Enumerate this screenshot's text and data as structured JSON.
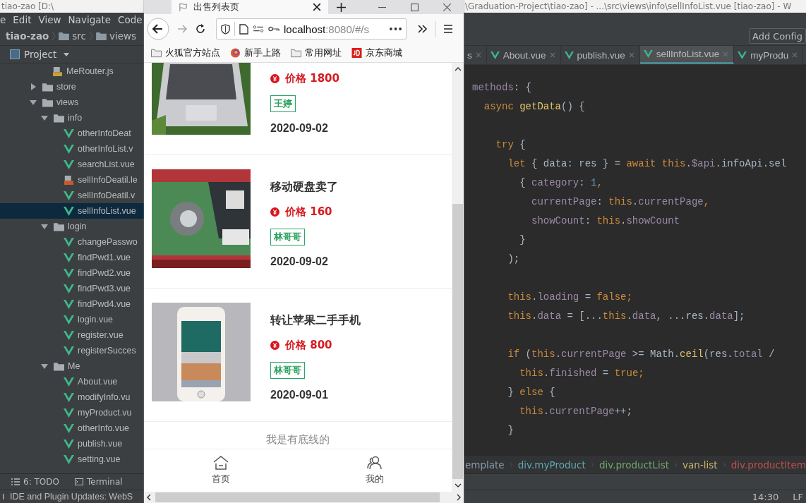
{
  "ide": {
    "title_left": "tiao-zao [D:\\",
    "title_right": "\\Graduation-Project\\tiao-zao] - ...\\src\\views\\info\\sellInfoList.vue [tiao-zao] - W",
    "menu": [
      "e",
      "Edit",
      "View",
      "Navigate",
      "Code"
    ],
    "path": [
      "tiao-zao",
      "src",
      "views"
    ],
    "add_config": "Add Config",
    "project_label": "Project",
    "tree": [
      {
        "label": "MeRouter.js",
        "kind": "js",
        "selected": false
      },
      {
        "label": "store",
        "kind": "folder",
        "expanded": false,
        "selected": false
      },
      {
        "label": "views",
        "kind": "folder",
        "expanded": true,
        "selected": false,
        "children": [
          {
            "label": "info",
            "kind": "folder",
            "expanded": true,
            "selected": false,
            "children": [
              {
                "label": "otherInfoDeat",
                "kind": "vue",
                "selected": false
              },
              {
                "label": "otherInfoList.v",
                "kind": "vue",
                "selected": false
              },
              {
                "label": "searchList.vue",
                "kind": "vue",
                "selected": false
              },
              {
                "label": "sellInfoDeatil.le",
                "kind": "less",
                "selected": false
              },
              {
                "label": "sellInfoDeatil.v",
                "kind": "vue",
                "selected": false
              },
              {
                "label": "sellInfoList.vue",
                "kind": "vue",
                "selected": true
              }
            ]
          },
          {
            "label": "login",
            "kind": "folder",
            "expanded": true,
            "selected": false,
            "children": [
              {
                "label": "changePasswo",
                "kind": "vue",
                "selected": false
              },
              {
                "label": "findPwd1.vue",
                "kind": "vue",
                "selected": false
              },
              {
                "label": "findPwd2.vue",
                "kind": "vue",
                "selected": false
              },
              {
                "label": "findPwd3.vue",
                "kind": "vue",
                "selected": false
              },
              {
                "label": "findPwd4.vue",
                "kind": "vue",
                "selected": false
              },
              {
                "label": "login.vue",
                "kind": "vue",
                "selected": false
              },
              {
                "label": "register.vue",
                "kind": "vue",
                "selected": false
              },
              {
                "label": "registerSucces",
                "kind": "vue",
                "selected": false
              }
            ]
          },
          {
            "label": "Me",
            "kind": "folder",
            "expanded": true,
            "selected": false,
            "children": [
              {
                "label": "About.vue",
                "kind": "vue",
                "selected": false
              },
              {
                "label": "modifyInfo.vu",
                "kind": "vue",
                "selected": false
              },
              {
                "label": "myProduct.vu",
                "kind": "vue",
                "selected": false
              },
              {
                "label": "otherInfo.vue",
                "kind": "vue",
                "selected": false
              },
              {
                "label": "publish.vue",
                "kind": "vue",
                "selected": false
              },
              {
                "label": "setting.vue",
                "kind": "vue",
                "selected": false
              }
            ]
          }
        ]
      }
    ],
    "tabs": [
      {
        "label": "s",
        "selected": false
      },
      {
        "label": "About.vue",
        "kind": "vue",
        "selected": false
      },
      {
        "label": "publish.vue",
        "kind": "vue",
        "selected": false
      },
      {
        "label": "sellInfoList.vue",
        "kind": "vue",
        "selected": true
      },
      {
        "label": "myProdu",
        "kind": "vue",
        "selected": false
      }
    ],
    "code": [
      {
        "kind": "code",
        "tokens": [
          {
            "t": "methods",
            "kind": "prop"
          },
          {
            "t": ": {",
            "kind": "plain"
          }
        ]
      },
      {
        "kind": "code",
        "tokens": [
          {
            "t": "  async",
            "kind": "kw"
          },
          {
            "t": " getData",
            "kind": "fn"
          },
          {
            "t": "() {",
            "kind": "plain"
          }
        ]
      },
      {
        "kind": "blank"
      },
      {
        "kind": "code",
        "tokens": [
          {
            "t": "    try",
            "kind": "kw"
          },
          {
            "t": " {",
            "kind": "plain"
          }
        ]
      },
      {
        "kind": "code",
        "tokens": [
          {
            "t": "      let",
            "kind": "kw"
          },
          {
            "t": " { data: res } = ",
            "kind": "plain"
          },
          {
            "t": "await this",
            "kind": "kw"
          },
          {
            "t": ".",
            "kind": "plain"
          },
          {
            "t": "$api",
            "kind": "prop"
          },
          {
            "t": ".infoApi.sel",
            "kind": "plain"
          }
        ]
      },
      {
        "kind": "code",
        "tokens": [
          {
            "t": "        { ",
            "kind": "plain"
          },
          {
            "t": "category",
            "kind": "prop"
          },
          {
            "t": ": ",
            "kind": "plain"
          },
          {
            "t": "1",
            "kind": "num"
          },
          {
            "t": ",",
            "kind": "kw"
          }
        ]
      },
      {
        "kind": "code",
        "tokens": [
          {
            "t": "          currentPage",
            "kind": "prop"
          },
          {
            "t": ": ",
            "kind": "plain"
          },
          {
            "t": "this",
            "kind": "kw"
          },
          {
            "t": ".",
            "kind": "plain"
          },
          {
            "t": "currentPage",
            "kind": "prop"
          },
          {
            "t": ",",
            "kind": "kw"
          }
        ]
      },
      {
        "kind": "code",
        "tokens": [
          {
            "t": "          showCount",
            "kind": "prop"
          },
          {
            "t": ": ",
            "kind": "plain"
          },
          {
            "t": "this",
            "kind": "kw"
          },
          {
            "t": ".",
            "kind": "plain"
          },
          {
            "t": "showCount",
            "kind": "prop"
          }
        ]
      },
      {
        "kind": "code",
        "tokens": [
          {
            "t": "        }",
            "kind": "plain"
          }
        ]
      },
      {
        "kind": "code",
        "tokens": [
          {
            "t": "      );",
            "kind": "plain"
          }
        ]
      },
      {
        "kind": "blank"
      },
      {
        "kind": "code",
        "tokens": [
          {
            "t": "      this",
            "kind": "kw"
          },
          {
            "t": ".",
            "kind": "plain"
          },
          {
            "t": "loading",
            "kind": "prop"
          },
          {
            "t": " = ",
            "kind": "plain"
          },
          {
            "t": "false",
            "kind": "kw"
          },
          {
            "t": ";",
            "kind": "kw"
          }
        ]
      },
      {
        "kind": "code",
        "tokens": [
          {
            "t": "      this",
            "kind": "kw"
          },
          {
            "t": ".",
            "kind": "plain"
          },
          {
            "t": "data",
            "kind": "prop"
          },
          {
            "t": " = [...",
            "kind": "plain"
          },
          {
            "t": "this",
            "kind": "kw"
          },
          {
            "t": ".",
            "kind": "plain"
          },
          {
            "t": "data",
            "kind": "prop"
          },
          {
            "t": ", ...res.",
            "kind": "plain"
          },
          {
            "t": "data",
            "kind": "prop"
          },
          {
            "t": "];",
            "kind": "plain"
          }
        ]
      },
      {
        "kind": "blank"
      },
      {
        "kind": "code",
        "tokens": [
          {
            "t": "      if",
            "kind": "kw"
          },
          {
            "t": " (",
            "kind": "plain"
          },
          {
            "t": "this",
            "kind": "kw"
          },
          {
            "t": ".",
            "kind": "plain"
          },
          {
            "t": "currentPage",
            "kind": "prop"
          },
          {
            "t": " >= Math.",
            "kind": "plain"
          },
          {
            "t": "ceil",
            "kind": "fn"
          },
          {
            "t": "(res.",
            "kind": "plain"
          },
          {
            "t": "total",
            "kind": "prop"
          },
          {
            "t": " /",
            "kind": "plain"
          }
        ]
      },
      {
        "kind": "code",
        "tokens": [
          {
            "t": "        this",
            "kind": "kw"
          },
          {
            "t": ".",
            "kind": "plain"
          },
          {
            "t": "finished",
            "kind": "prop"
          },
          {
            "t": " = ",
            "kind": "plain"
          },
          {
            "t": "true",
            "kind": "kw"
          },
          {
            "t": ";",
            "kind": "kw"
          }
        ]
      },
      {
        "kind": "code",
        "tokens": [
          {
            "t": "      } ",
            "kind": "plain"
          },
          {
            "t": "else",
            "kind": "kw"
          },
          {
            "t": " {",
            "kind": "plain"
          }
        ]
      },
      {
        "kind": "code",
        "tokens": [
          {
            "t": "        this",
            "kind": "kw"
          },
          {
            "t": ".",
            "kind": "plain"
          },
          {
            "t": "currentPage",
            "kind": "prop"
          },
          {
            "t": "++;",
            "kind": "plain"
          }
        ]
      },
      {
        "kind": "code",
        "tokens": [
          {
            "t": "      }",
            "kind": "plain"
          }
        ]
      }
    ],
    "crumbs": [
      {
        "label": "emplate",
        "color": "#8a9aa8"
      },
      {
        "label": "div.myProduct",
        "color": "#5fa8b0"
      },
      {
        "label": "div.productList",
        "color": "#6fa86a"
      },
      {
        "label": "van-list",
        "color": "#c8b46a"
      },
      {
        "label": "div.productItem",
        "color": "#c0504d"
      }
    ],
    "tools": [
      {
        "label": "6: TODO",
        "kind": "list"
      },
      {
        "label": "Terminal",
        "kind": "terminal"
      }
    ],
    "status": {
      "message": "IDE and Plugin Updates: WebS",
      "time": "14:30",
      "line_sep": "LF"
    }
  },
  "browser": {
    "tab_title": "出售列表页",
    "url_host": "localhost",
    "url_rest": ":8080/#/s",
    "bookmarks": [
      {
        "label": "火狐官方站点",
        "kind": "folder"
      },
      {
        "label": "新手上路",
        "kind": "firefox"
      },
      {
        "label": "常用网址",
        "kind": "folder"
      },
      {
        "label": "京东商城",
        "kind": "jd"
      }
    ],
    "products": [
      {
        "price": "价格 1800",
        "seller": "王婷",
        "date": "2020-09-02"
      },
      {
        "title": "移动硬盘卖了",
        "price": "价格 160",
        "seller": "林哥哥",
        "date": "2020-09-02"
      },
      {
        "title": "转让苹果二手手机",
        "price": "价格 800",
        "seller": "林哥哥",
        "date": "2020-09-01"
      }
    ],
    "end_note": "我是有底线的",
    "nav": [
      {
        "label": "首页",
        "kind": "home"
      },
      {
        "label": "我的",
        "kind": "user"
      }
    ]
  }
}
